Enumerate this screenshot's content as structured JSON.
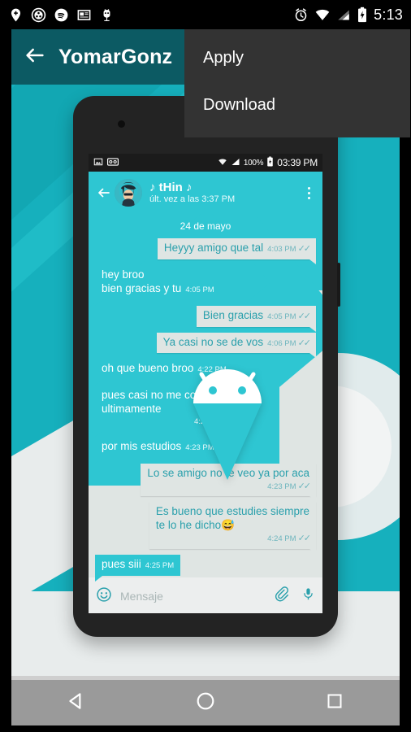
{
  "system_status_bar": {
    "left_icons": [
      "location-plus-icon",
      "soccer-ball-icon",
      "spotify-icon",
      "news-card-icon",
      "alien-bot-icon"
    ],
    "right_icons": [
      "alarm-clock-icon",
      "wifi-icon",
      "signal-icon",
      "battery-charging-icon"
    ],
    "clock": "5:13"
  },
  "appbar": {
    "back_icon": "back-arrow-icon",
    "title": "YomarGonz"
  },
  "overflow_menu": {
    "items": [
      {
        "label": "Apply"
      },
      {
        "label": "Download"
      }
    ]
  },
  "preview": {
    "phone_status_bar": {
      "left_icons": [
        "image-icon",
        "voicemail-icon"
      ],
      "wifi_icon": "wifi-icon",
      "signal_icon": "signal-icon",
      "battery_text": "100%",
      "battery_icon": "battery-charging-icon",
      "time": "03:39 PM"
    },
    "chat_header": {
      "back_icon": "back-arrow-icon",
      "avatar": "contact-avatar",
      "name": "♪ tHin ♪",
      "status": "últ. vez a las 3:37 PM",
      "overflow_icon": "overflow-dots-icon"
    },
    "day_divider": "24 de mayo",
    "messages": [
      {
        "dir": "out",
        "text": "Heyyy amigo que tal",
        "time": "4:03 PM",
        "ticks": "✓✓",
        "inline_meta": true
      },
      {
        "dir": "in",
        "text": "hey broo\nbien gracias y tu",
        "time": "4:05 PM",
        "ticks": "",
        "inline_meta": true
      },
      {
        "dir": "out",
        "text": "Bien gracias",
        "time": "4:05 PM",
        "ticks": "✓✓",
        "inline_meta": true
      },
      {
        "dir": "out",
        "text": "Ya casi no se de vos",
        "time": "4:06 PM",
        "ticks": "✓✓",
        "inline_meta": true
      },
      {
        "dir": "in",
        "text": "oh que bueno broo",
        "time": "4:22 PM",
        "ticks": "",
        "inline_meta": true
      },
      {
        "dir": "in",
        "text": "pues casi no me conecto\nultimamente",
        "time": "4:23 PM",
        "ticks": "",
        "inline_meta": false
      },
      {
        "dir": "in",
        "text": "por mis estudios",
        "time": "4:23 PM",
        "ticks": "",
        "inline_meta": true
      },
      {
        "dir": "out",
        "text": "Lo se amigo no te veo ya por aca",
        "time": "4:23 PM",
        "ticks": "✓✓",
        "inline_meta": false
      },
      {
        "dir": "out",
        "text": "Es bueno que estudies siempre\nte lo he dicho😅",
        "time": "4:24 PM",
        "ticks": "✓✓",
        "inline_meta": false
      },
      {
        "dir": "in",
        "text": "pues siii",
        "time": "4:25 PM",
        "ticks": "",
        "inline_meta": true
      }
    ],
    "input_bar": {
      "emoji_icon": "emoji-smiley-icon",
      "placeholder": "Mensaje",
      "attach_icon": "paperclip-icon",
      "mic_icon": "microphone-icon"
    },
    "watermark_icon": "android-robot-icon"
  },
  "navigation_bar": {
    "back": "nav-back-triangle-icon",
    "home": "nav-home-circle-icon",
    "recents": "nav-recents-square-icon"
  },
  "colors": {
    "appbar": "#0c5a63",
    "accent_cyan": "#2ec6d2",
    "wallpaper_cyan": "#16b0bd",
    "bubble_out": "#dfe5e3",
    "bubble_out_text": "#2aa0ac",
    "menu_bg": "#333333",
    "nav_bg": "#9a9a9a"
  }
}
